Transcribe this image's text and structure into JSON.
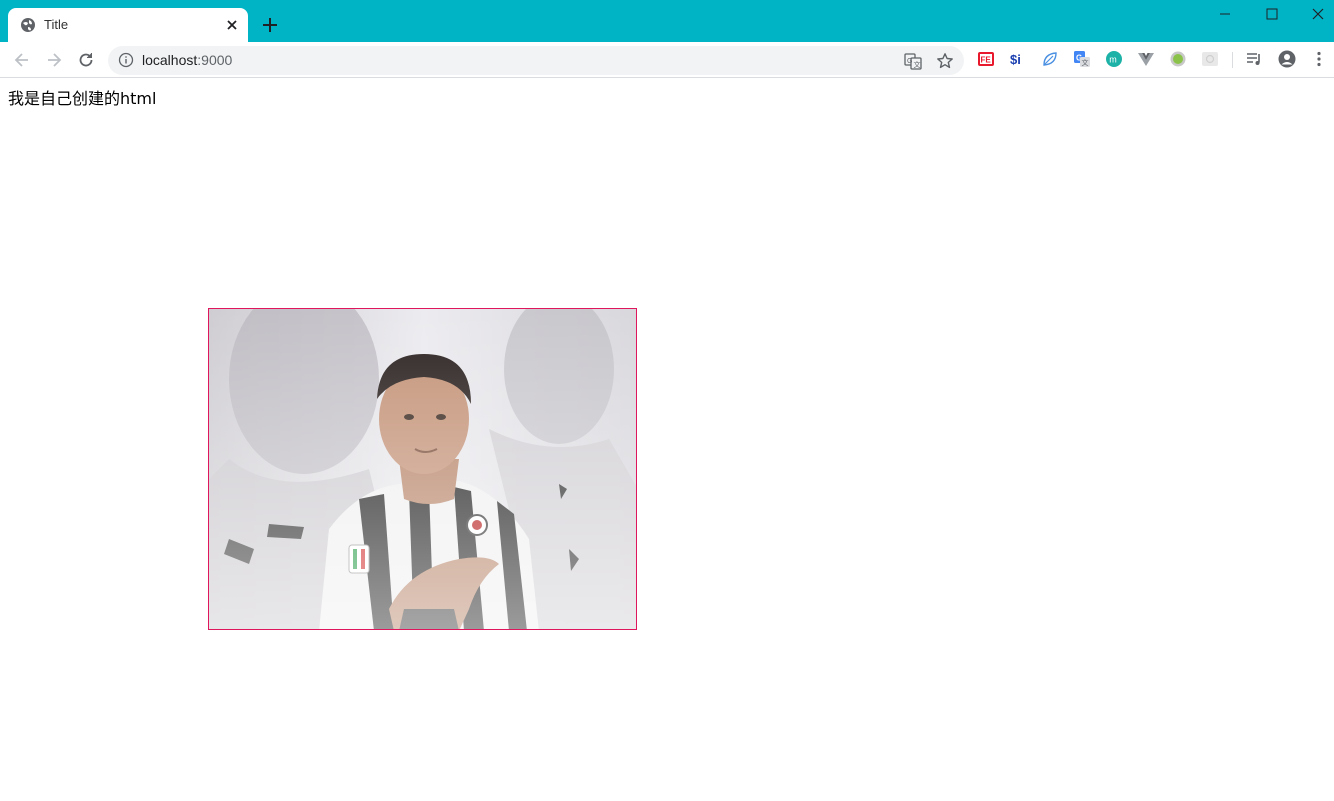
{
  "browser": {
    "tab": {
      "title": "Title",
      "favicon": "globe-icon"
    },
    "new_tab_icon": "plus-icon",
    "window_controls": [
      "minimize-icon",
      "maximize-icon",
      "close-icon"
    ],
    "address_bar": {
      "host": "localhost",
      "port": ":9000"
    },
    "extensions": [
      "fe-extension-icon",
      "dollar-i-extension-icon",
      "leaf-extension-icon",
      "google-translate-extension-icon",
      "m-extension-icon",
      "vue-devtools-extension-icon",
      "green-circle-extension-icon",
      "gray-box-extension-icon",
      "reading-list-icon",
      "profile-icon",
      "menu-icon"
    ]
  },
  "page": {
    "text": "我是自己创建的html",
    "image": {
      "subject": "football-player-photo"
    }
  },
  "colors": {
    "titlebar": "#00b4c6",
    "image_border": "#e0165c"
  }
}
